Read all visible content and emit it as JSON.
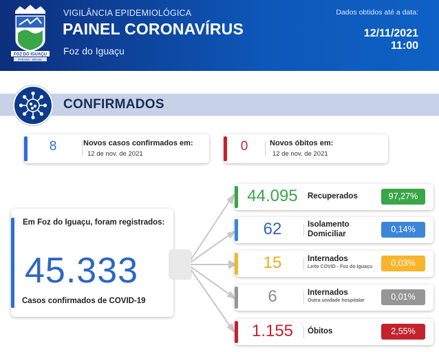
{
  "header": {
    "subtitle": "VIGILÂNCIA EPIDEMIOLÓGICA",
    "title": "PAINEL CORONAVÍRUS",
    "city": "Foz do Iguaçu",
    "data_label": "Dados obtidos até a data:",
    "date": "12/11/2021",
    "time": "11:00",
    "crest_text": "FOZ DO IGUAÇU",
    "crest_ribbon": "PARANÁ · BRASIL"
  },
  "section": {
    "title": "CONFIRMADOS"
  },
  "new_cases": {
    "value": "8",
    "label": "Novos casos confirmados em:",
    "date": "12 de nov. de 2021",
    "accent": "#2f6ed0"
  },
  "new_deaths": {
    "value": "0",
    "label": "Novos óbitos em:",
    "date": "12 de nov. de 2021",
    "accent": "#c4222e"
  },
  "total": {
    "intro": "Em Foz do Iguaçu, foram registrados:",
    "value": "45.333",
    "caption": "Casos confirmados de COVID-19",
    "accent": "#2f6ed0"
  },
  "stats": [
    {
      "value": "44.095",
      "label": "Recuperados",
      "pct": "97,27%",
      "color": "#3aa648",
      "num_color": "#3aa648"
    },
    {
      "value": "62",
      "label": "Isolamento",
      "label2": "Domiciliar",
      "pct": "0,14%",
      "color": "#3b86d9",
      "num_color": "#2c66c2"
    },
    {
      "value": "15",
      "label": "Internados",
      "label2": "Leito COVID - Foz do Iguaçu",
      "pct": "0,03%",
      "color": "#f7b52b",
      "num_color": "#f3a91d"
    },
    {
      "value": "6",
      "label": "Internados",
      "label2": "Outra unidade hospitalar",
      "pct": "0,01%",
      "color": "#969696",
      "num_color": "#8a8a8a"
    },
    {
      "value": "1.155",
      "label": "Óbitos",
      "pct": "2,55%",
      "color": "#c4222e",
      "num_color": "#c4222e"
    }
  ]
}
